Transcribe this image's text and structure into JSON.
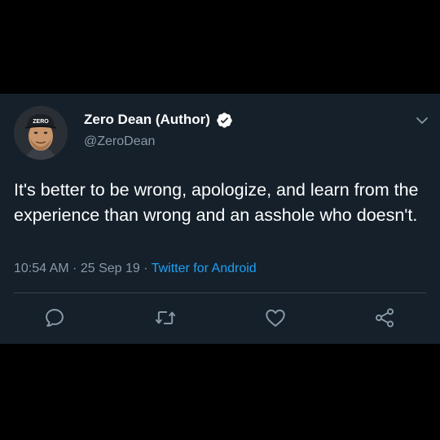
{
  "tweet": {
    "display_name": "Zero Dean (Author)",
    "handle": "@ZeroDean",
    "avatar_cap_text": "ZERO",
    "text": "It's better to be wrong, apologize, and learn from the experience than wrong and an asshole who doesn't.",
    "time": "10:54 AM",
    "separator1": " · ",
    "date": "25 Sep 19",
    "separator2": " · ",
    "source": "Twitter for Android"
  },
  "icons": {
    "verified": "verified-badge-icon",
    "menu": "chevron-down-icon",
    "reply": "reply-icon",
    "retweet": "retweet-icon",
    "like": "heart-icon",
    "share": "share-icon"
  },
  "colors": {
    "background": "#15202b",
    "text": "#ffffff",
    "secondary_text": "#8899a6",
    "accent": "#1da1f2",
    "divider": "#38444d"
  }
}
